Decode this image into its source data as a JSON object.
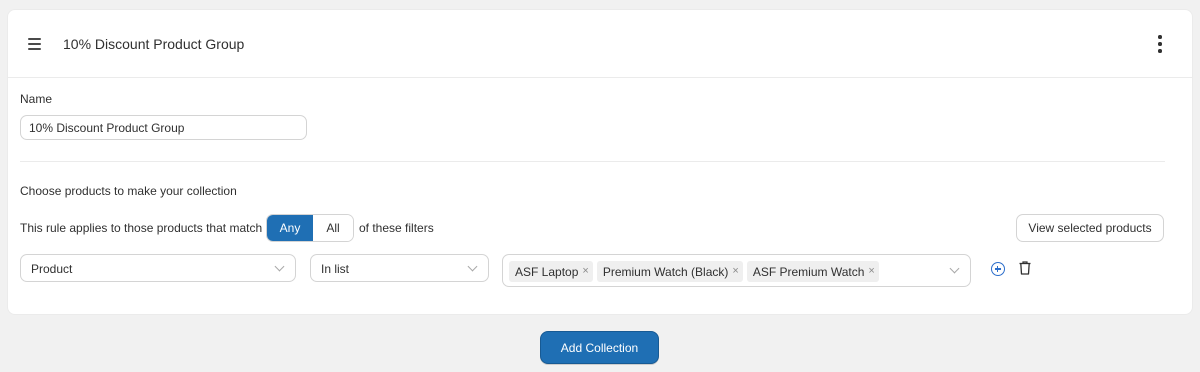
{
  "header": {
    "title": "10% Discount Product Group",
    "menu_icon": "hamburger-icon",
    "more_icon": "kebab-icon"
  },
  "form": {
    "name_label": "Name",
    "name_value": "10% Discount Product Group",
    "choose_label": "Choose products to make your collection",
    "rule_prefix": "This rule applies to those products that match",
    "rule_suffix": "of these filters",
    "match_options": [
      "Any",
      "All"
    ],
    "match_selected": "Any",
    "view_selected_label": "View selected products"
  },
  "condition": {
    "field": "Product",
    "operator": "In list",
    "values": [
      "ASF Laptop",
      "Premium Watch (Black)",
      "ASF Premium Watch"
    ],
    "remove_glyph": "×",
    "add_icon": "plus-circle-icon",
    "delete_icon": "trash-icon"
  },
  "footer": {
    "add_collection_label": "Add Collection"
  },
  "colors": {
    "primary": "#1f6fb4",
    "add_icon": "#2c6ecb",
    "background": "#f1f1f1"
  }
}
